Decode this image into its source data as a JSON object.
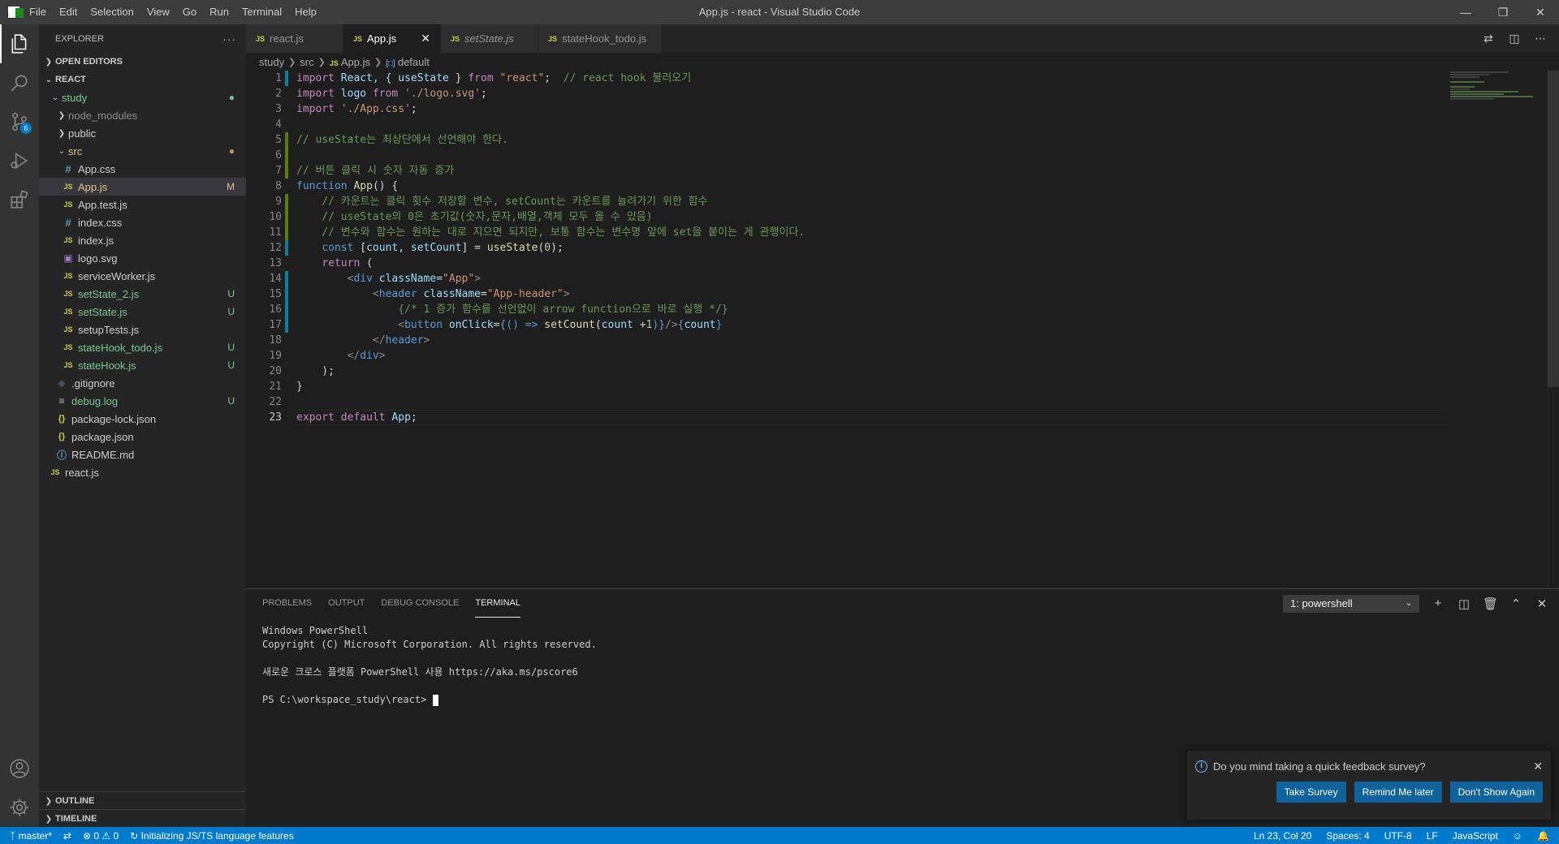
{
  "menu": [
    "File",
    "Edit",
    "Selection",
    "View",
    "Go",
    "Run",
    "Terminal",
    "Help"
  ],
  "window_title": "App.js - react - Visual Studio Code",
  "activity": {
    "scm_badge": "6"
  },
  "sidebar": {
    "title": "EXPLORER",
    "more": "···",
    "open_editors": "OPEN EDITORS",
    "root": "REACT",
    "tree": [
      {
        "label": "study",
        "status": "●"
      },
      {
        "label": "node_modules",
        "status": ""
      },
      {
        "label": "public",
        "status": ""
      },
      {
        "label": "src",
        "status": "●"
      },
      {
        "label": "App.css",
        "status": ""
      },
      {
        "label": "App.js",
        "status": "M"
      },
      {
        "label": "App.test.js",
        "status": ""
      },
      {
        "label": "index.css",
        "status": ""
      },
      {
        "label": "index.js",
        "status": ""
      },
      {
        "label": "logo.svg",
        "status": ""
      },
      {
        "label": "serviceWorker.js",
        "status": ""
      },
      {
        "label": "setState_2.js",
        "status": "U"
      },
      {
        "label": "setState.js",
        "status": "U"
      },
      {
        "label": "setupTests.js",
        "status": ""
      },
      {
        "label": "stateHook_todo.js",
        "status": "U"
      },
      {
        "label": "stateHook.js",
        "status": "U"
      },
      {
        "label": ".gitignore",
        "status": ""
      },
      {
        "label": "debug.log",
        "status": "U"
      },
      {
        "label": "package-lock.json",
        "status": ""
      },
      {
        "label": "package.json",
        "status": ""
      },
      {
        "label": "README.md",
        "status": ""
      },
      {
        "label": "react.js",
        "status": ""
      }
    ],
    "outline": "OUTLINE",
    "timeline": "TIMELINE"
  },
  "tabs": [
    {
      "label": "react.js"
    },
    {
      "label": "App.js"
    },
    {
      "label": "setState.js"
    },
    {
      "label": "stateHook_todo.js"
    }
  ],
  "breadcrumb": [
    "study",
    "src",
    "App.js",
    "default"
  ],
  "code": {
    "line_numbers": [
      "1",
      "2",
      "3",
      "4",
      "5",
      "6",
      "7",
      "8",
      "9",
      "10",
      "11",
      "12",
      "13",
      "14",
      "15",
      "16",
      "17",
      "18",
      "19",
      "20",
      "21",
      "22",
      "23"
    ],
    "l1": [
      "import",
      " React, { ",
      "useState",
      " } ",
      "from",
      " ",
      "\"react\"",
      ";  ",
      "// react hook 불러오기"
    ],
    "l2": [
      "import",
      " ",
      "logo",
      " ",
      "from",
      " ",
      "'./logo.svg'",
      ";"
    ],
    "l3": [
      "import",
      " ",
      "'./App.css'",
      ";"
    ],
    "l5": "// useState는 최상단에서 선언해야 한다.",
    "l7": "// 버튼 클릭 시 숫자 자동 증가",
    "l8": [
      "function",
      " ",
      "App",
      "() {"
    ],
    "l9": "    // 카운트는 클릭 횟수 저장할 변수, setCount는 카운트를 늘려가기 위한 함수",
    "l10": "    // useState의 0은 초기값(숫자,문자,배열,객체 모두 올 수 있음)",
    "l11": "    // 변수와 함수는 원하는 대로 지으면 되지만, 보통 함수는 변수명 앞에 set을 붙이는 게 관행이다.",
    "l12": [
      "    ",
      "const",
      " [",
      "count",
      ", ",
      "setCount",
      "] = ",
      "useState",
      "(",
      "0",
      ");"
    ],
    "l13": [
      "    ",
      "return",
      " ("
    ],
    "l14": [
      "        ",
      "<",
      "div",
      " ",
      "className",
      "=",
      "\"App\"",
      ">"
    ],
    "l15": [
      "            ",
      "<",
      "header",
      " ",
      "className",
      "=",
      "\"App-header\"",
      ">"
    ],
    "l16": [
      "                ",
      "{/* 1 증가 함수를 선언없이 arrow function으로 바로 실행 */}"
    ],
    "l17": [
      "                ",
      "<",
      "button",
      " ",
      "onClick",
      "=",
      "{() ",
      "=>",
      " ",
      "setCount",
      "(",
      "count",
      " +",
      "1",
      ")}",
      "/>",
      "{",
      "count",
      "}"
    ],
    "l18": [
      "            ",
      "</",
      "header",
      ">"
    ],
    "l19": [
      "        ",
      "</",
      "div",
      ">"
    ],
    "l20": "    );",
    "l21": "}",
    "l23": [
      "export",
      " ",
      "default",
      " ",
      "App",
      ";"
    ]
  },
  "panel": {
    "tabs": [
      "PROBLEMS",
      "OUTPUT",
      "DEBUG CONSOLE",
      "TERMINAL"
    ],
    "terminal_select": "1: powershell",
    "terminal_lines": [
      "Windows PowerShell",
      "Copyright (C) Microsoft Corporation. All rights reserved.",
      "",
      "새로운 크로스 플랫폼 PowerShell 사용 https://aka.ms/pscore6",
      "",
      "PS C:\\workspace_study\\react> "
    ]
  },
  "notification": {
    "message": "Do you mind taking a quick feedback survey?",
    "buttons": [
      "Take Survey",
      "Remind Me later",
      "Don't Show Again"
    ]
  },
  "statusbar": {
    "branch": "master*",
    "errors": "0",
    "warnings": "0",
    "task": "Initializing JS/TS language features",
    "position": "Ln 23, Col 20",
    "spaces": "Spaces: 4",
    "encoding": "UTF-8",
    "eol": "LF",
    "language": "JavaScript"
  },
  "colors": {
    "accent": "#007acc",
    "untracked": "#73c991",
    "modified": "#e2c08d"
  }
}
